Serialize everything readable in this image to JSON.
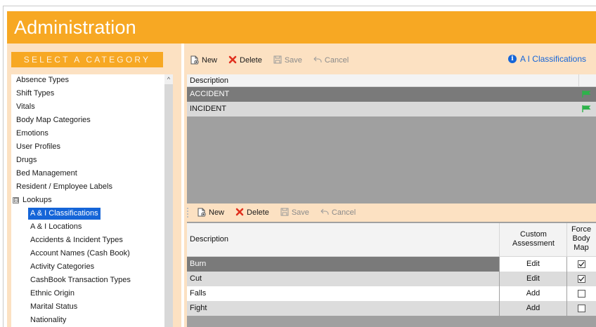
{
  "app": {
    "title": "Administration"
  },
  "sidebar": {
    "heading": "SELECT A CATEGORY",
    "items": [
      {
        "label": "Absence Types"
      },
      {
        "label": "Shift Types"
      },
      {
        "label": "Vitals"
      },
      {
        "label": "Body Map Categories"
      },
      {
        "label": "Emotions"
      },
      {
        "label": "User Profiles"
      },
      {
        "label": "Drugs"
      },
      {
        "label": "Bed Management"
      },
      {
        "label": "Resident / Employee Labels"
      },
      {
        "label": "Lookups",
        "expander": "⊟"
      },
      {
        "label": "A & I Classifications"
      },
      {
        "label": "A & I Locations"
      },
      {
        "label": "Accidents & Incident Types"
      },
      {
        "label": "Account Names (Cash Book)"
      },
      {
        "label": "Activity Categories"
      },
      {
        "label": "CashBook Transaction Types"
      },
      {
        "label": "Ethnic Origin"
      },
      {
        "label": "Marital Status"
      },
      {
        "label": "Nationality"
      }
    ],
    "selected_index": 10,
    "scroll_up_glyph": "^"
  },
  "toolbar1": {
    "new_label": "New",
    "delete_label": "Delete",
    "save_label": "Save",
    "cancel_label": "Cancel"
  },
  "breadcrumb": {
    "info_glyph": "i",
    "label": "A  I Classifications"
  },
  "grid1": {
    "header": "Description",
    "rows": [
      {
        "description": "ACCIDENT"
      },
      {
        "description": "INCIDENT"
      }
    ]
  },
  "toolbar2": {
    "new_label": "New",
    "delete_label": "Delete",
    "save_label": "Save",
    "cancel_label": "Cancel"
  },
  "grid2": {
    "header_description": "Description",
    "header_custom": "Custom Assessment",
    "header_force": "Force Body Map",
    "rows": [
      {
        "description": "Burn",
        "action": "Edit",
        "force": "☑"
      },
      {
        "description": "Cut",
        "action": "Edit",
        "force": "☑"
      },
      {
        "description": "Falls",
        "action": "Add",
        "force": "☐"
      },
      {
        "description": "Fight",
        "action": "Add",
        "force": "☐"
      }
    ]
  },
  "colors": {
    "accent_orange": "#f7a823",
    "panel_peach": "#fce1c2",
    "selection_blue": "#1565d8",
    "flag_green": "#2db34a",
    "delete_red": "#e0301e"
  },
  "icons": {
    "new": "new-document-icon",
    "delete": "delete-x-icon",
    "save": "save-disk-icon",
    "cancel": "undo-arrow-icon",
    "flag": "green-flag-icon",
    "info": "info-icon"
  }
}
